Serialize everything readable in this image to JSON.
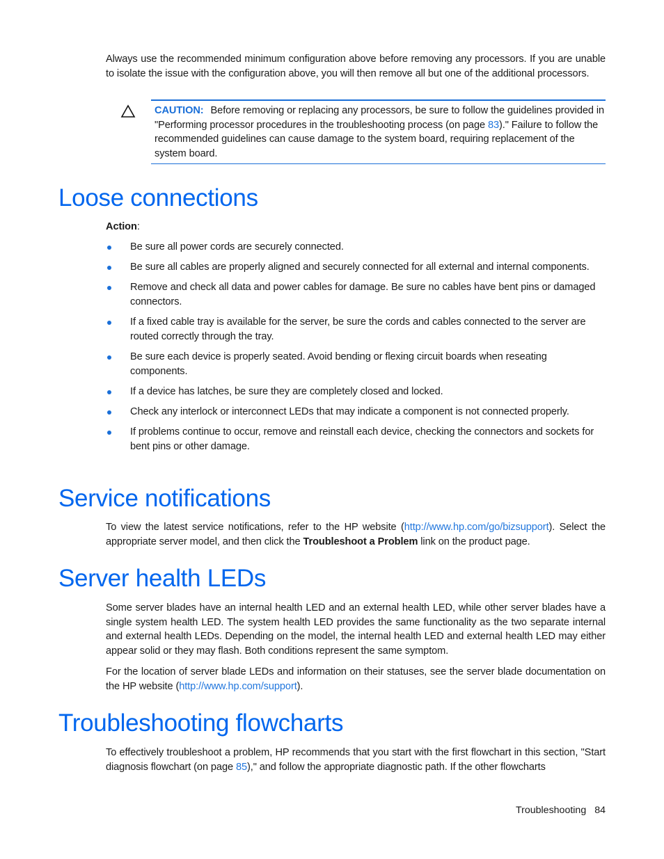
{
  "intro_paragraph": "Always use the recommended minimum configuration above before removing any processors. If you are unable to isolate the issue with the configuration above, you will then remove all but one of the additional processors.",
  "caution": {
    "icon": "warning-triangle-icon",
    "label": "CAUTION:",
    "text_before_link": "Before removing or replacing any processors, be sure to follow the guidelines provided in \"Performing processor procedures in the troubleshooting process (on page ",
    "page_link": "83",
    "text_after_link": ").\" Failure to follow the recommended guidelines can cause damage to the system board, requiring replacement of the system board."
  },
  "loose_connections": {
    "heading": "Loose connections",
    "action_label": "Action",
    "action_suffix": ":",
    "bullets": [
      "Be sure all power cords are securely connected.",
      "Be sure all cables are properly aligned and securely connected for all external and internal components.",
      "Remove and check all data and power cables for damage. Be sure no cables have bent pins or damaged connectors.",
      "If a fixed cable tray is available for the server, be sure the cords and cables connected to the server are routed correctly through the tray.",
      "Be sure each device is properly seated. Avoid bending or flexing circuit boards when reseating components.",
      "If a device has latches, be sure they are completely closed and locked.",
      "Check any interlock or interconnect LEDs that may indicate a component is not connected properly.",
      "If problems continue to occur, remove and reinstall each device, checking the connectors and sockets for bent pins or other damage."
    ]
  },
  "service_notifications": {
    "heading": "Service notifications",
    "text_before_link": "To view the latest service notifications, refer to the HP website (",
    "link": "http://www.hp.com/go/bizsupport",
    "text_middle": "). Select the appropriate server model, and then click the ",
    "bold": "Troubleshoot a Problem",
    "text_after": " link on the product page."
  },
  "server_health_leds": {
    "heading": "Server health LEDs",
    "paragraph1": "Some server blades have an internal health LED and an external health LED, while other server blades have a single system health LED. The system health LED provides the same functionality as the two separate internal and external health LEDs. Depending on the model, the internal health LED and external health LED may either appear solid or they may flash. Both conditions represent the same symptom.",
    "paragraph2_before_link": "For the location of server blade LEDs and information on their statuses, see the server blade documentation on the HP website (",
    "link": "http://www.hp.com/support",
    "paragraph2_after_link": ")."
  },
  "troubleshooting_flowcharts": {
    "heading": "Troubleshooting flowcharts",
    "text_before_link": "To effectively troubleshoot a problem, HP recommends that you start with the first flowchart in this section, \"Start diagnosis flowchart (on page ",
    "page_link": "85",
    "text_after_link": "),\" and follow the appropriate diagnostic path. If the other flowcharts"
  },
  "footer": {
    "section": "Troubleshooting",
    "page_number": "84"
  }
}
